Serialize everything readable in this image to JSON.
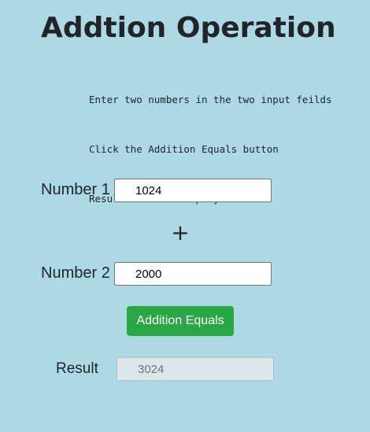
{
  "page": {
    "title": "Addtion Operation",
    "instructions": [
      "Enter two numbers in the two input feilds",
      "Click the Addition Equals button",
      "Result will be displayed"
    ]
  },
  "form": {
    "number1": {
      "label": "Number 1",
      "value": "1024"
    },
    "operator": "+",
    "number2": {
      "label": "Number 2",
      "value": "2000"
    },
    "button_label": "Addition Equals",
    "result": {
      "label": "Result",
      "value": "3024"
    }
  },
  "colors": {
    "background": "#add8e6",
    "button": "#28a745",
    "button_text": "#ffffff",
    "result_field": "#dde6ea"
  }
}
